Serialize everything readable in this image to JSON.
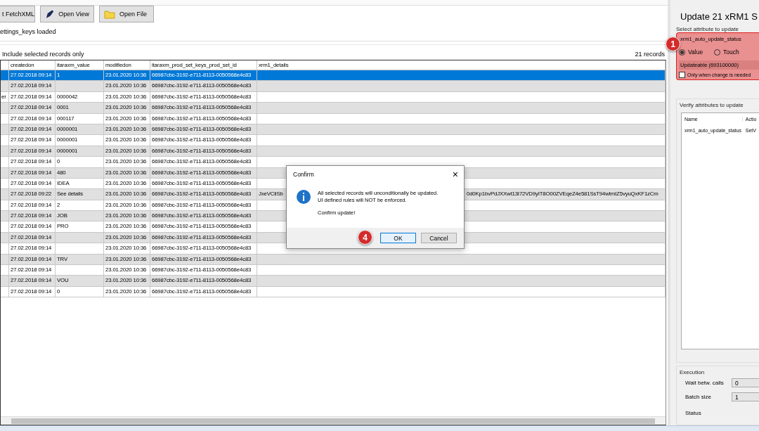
{
  "toolbar": {
    "buttons": [
      {
        "label": "t FetchXML"
      },
      {
        "label": "Open View"
      },
      {
        "label": "Open File"
      }
    ]
  },
  "status_message": "ettings_keys loaded",
  "include_selected_label": "Include selected records only",
  "record_count": "21 records",
  "table": {
    "columns": [
      "createdon",
      "itaraxm_value",
      "modifiedon",
      "itaraxm_prod_set_keys_prod_set_id",
      "xrm1_details"
    ],
    "rows": [
      {
        "selected": true,
        "createdon": "27.02.2018 09:14",
        "value": "1",
        "modifiedon": "23.01.2020 10:36",
        "id": "66987cbc-3192-e711-8113-0050568e4c83"
      },
      {
        "selected": false,
        "createdon": "27.02.2018 09:14",
        "modifiedon": "23.01.2020 10:36",
        "id": "66987cbc-3192-e711-8113-0050568e4c83"
      },
      {
        "selected": false,
        "column_1": "er",
        "createdon": "27.02.2018 09:14",
        "value": "0000042",
        "modifiedon": "23.01.2020 10:36",
        "id": "66987cbc-3192-e711-8113-0050568e4c83"
      },
      {
        "selected": false,
        "createdon": "27.02.2018 09:14",
        "value": "0001",
        "modifiedon": "23.01.2020 10:36",
        "id": "66987cbc-3192-e711-8113-0050568e4c83"
      },
      {
        "selected": false,
        "createdon": "27.02.2018 09:14",
        "value": "000117",
        "modifiedon": "23.01.2020 10:36",
        "id": "66987cbc-3192-e711-8113-0050568e4c83"
      },
      {
        "selected": false,
        "createdon": "27.02.2018 09:14",
        "value": "0000001",
        "modifiedon": "23.01.2020 10:36",
        "id": "66987cbc-3192-e711-8113-0050568e4c83"
      },
      {
        "selected": false,
        "createdon": "27.02.2018 09:14",
        "value": "0000001",
        "modifiedon": "23.01.2020 10:36",
        "id": "66987cbc-3192-e711-8113-0050568e4c83"
      },
      {
        "selected": false,
        "createdon": "27.02.2018 09:14",
        "value": "0000001",
        "modifiedon": "23.01.2020 10:36",
        "id": "66987cbc-3192-e711-8113-0050568e4c83"
      },
      {
        "selected": false,
        "createdon": "27.02.2018 09:14",
        "value": "0",
        "modifiedon": "23.01.2020 10:36",
        "id": "66987cbc-3192-e711-8113-0050568e4c83"
      },
      {
        "selected": false,
        "createdon": "27.02.2018 09:14",
        "value": "480",
        "modifiedon": "23.01.2020 10:36",
        "id": "66987cbc-3192-e711-8113-0050568e4c83"
      },
      {
        "selected": false,
        "createdon": "27.02.2018 09:14",
        "value": "IDEA",
        "modifiedon": "23.01.2020 10:36",
        "id": "66987cbc-3192-e711-8113-0050568e4c83"
      },
      {
        "selected": false,
        "createdon": "27.02.2018 09:22",
        "value": "See details",
        "modifiedon": "23.01.2020 10:36",
        "id": "66987cbc-3192-e711-8113-0050568e4c83",
        "details": "JxeVCliSb",
        "details_continued": "0d0Kp1bvPdJXXwt13I72VD9yIT8O00ZVEqeZ4e581SsT94wtmIZ5vyuQxKF1zCm"
      },
      {
        "selected": false,
        "createdon": "27.02.2018 09:14",
        "value": "2",
        "modifiedon": "23.01.2020 10:36",
        "id": "66987cbc-3192-e711-8113-0050568e4c83"
      },
      {
        "selected": false,
        "createdon": "27.02.2018 09:14",
        "value": "JOB",
        "modifiedon": "23.01.2020 10:36",
        "id": "66987cbc-3192-e711-8113-0050568e4c83"
      },
      {
        "selected": false,
        "createdon": "27.02.2018 09:14",
        "value": "PRO",
        "modifiedon": "23.01.2020 10:36",
        "id": "66987cbc-3192-e711-8113-0050568e4c83"
      },
      {
        "selected": false,
        "createdon": "27.02.2018 09:14",
        "modifiedon": "23.01.2020 10:36",
        "id": "66987cbc-3192-e711-8113-0050568e4c83"
      },
      {
        "selected": false,
        "createdon": "27.02.2018 09:14",
        "modifiedon": "23.01.2020 10:36",
        "id": "66987cbc-3192-e711-8113-0050568e4c83"
      },
      {
        "selected": false,
        "createdon": "27.02.2018 09:14",
        "value": "TRV",
        "modifiedon": "23.01.2020 10:36",
        "id": "66987cbc-3192-e711-8113-0050568e4c83"
      },
      {
        "selected": false,
        "createdon": "27.02.2018 09:14",
        "modifiedon": "23.01.2020 10:36",
        "id": "66987cbc-3192-e711-8113-0050568e4c83"
      },
      {
        "selected": false,
        "createdon": "27.02.2018 09:14",
        "value": "VOU",
        "modifiedon": "23.01.2020 10:36",
        "id": "66987cbc-3192-e711-8113-0050568e4c83"
      },
      {
        "selected": false,
        "createdon": "27.02.2018 09:14",
        "value": "0",
        "modifiedon": "23.01.2020 10:36",
        "id": "66987cbc-3192-e711-8113-0050568e4c83"
      }
    ]
  },
  "dialog": {
    "title": "Confirm",
    "close": "×",
    "message_lines": [
      "All selected records will unconditionally be updated.",
      "UI defined rules will NOT be enforced."
    ],
    "confirm": "Confirm update!",
    "buttons": [
      {
        "label": "OK",
        "default": true
      },
      {
        "label": "Cancel",
        "default": false
      }
    ],
    "badge": "4"
  },
  "side_panel": {
    "title": "Update 21 xRM1 S",
    "select_group": "Select attribute to update",
    "badge": "1",
    "attribute": "xrm1_auto_update_status",
    "radios": [
      {
        "label": "Value",
        "selected": true
      },
      {
        "label": "Touch",
        "selected": false
      }
    ],
    "value_field": "Updateable (693100000)",
    "only_when_changed": {
      "label": "Only when change is needed",
      "checked": false
    },
    "verify_group": "Verify attributes to update",
    "verify_columns": [
      "Name",
      "Actio"
    ],
    "verify_rows": [
      {
        "name": "xrm1_auto_update_status",
        "action": "SetV"
      }
    ],
    "execution": {
      "title": "Execution",
      "wait_label": "Wait betw. calls",
      "wait_value": "0",
      "batch_label": "Batch size",
      "batch_value": "1",
      "status_label": "Status"
    }
  }
}
